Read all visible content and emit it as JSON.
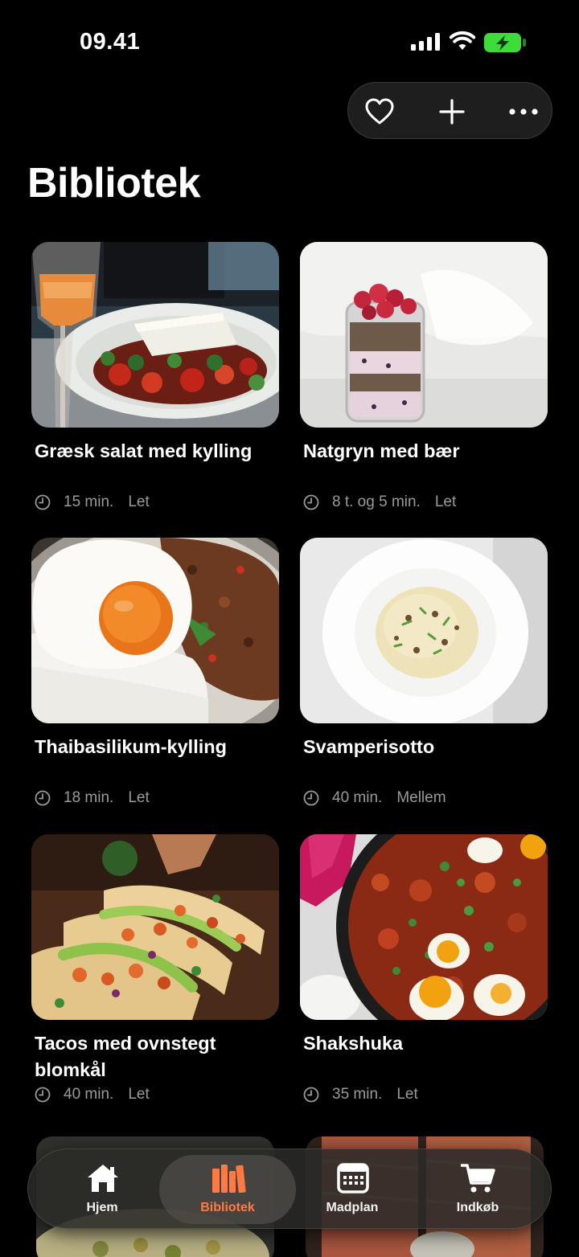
{
  "status_bar": {
    "time": "09.41",
    "icons": [
      "cellular-signal-icon",
      "wifi-icon",
      "battery-charging-icon"
    ],
    "battery_color": "#3ddc3a"
  },
  "toolbar": {
    "icons": [
      "heart-icon",
      "plus-icon",
      "more-icon"
    ]
  },
  "page_title": "Bibliotek",
  "recipes": [
    {
      "title": "Græsk salat med kylling",
      "time": "15 min.",
      "level": "Let",
      "image": "greek-salad-image"
    },
    {
      "title": "Natgryn med bær",
      "time": "8 t. og 5 min.",
      "level": "Let",
      "image": "overnight-oats-image"
    },
    {
      "title": "Thaibasilikum-kylling",
      "time": "18 min.",
      "level": "Let",
      "image": "thai-basil-chicken-image"
    },
    {
      "title": "Svamperisotto",
      "time": "40 min.",
      "level": "Mellem",
      "image": "mushroom-risotto-image"
    },
    {
      "title": "Tacos med ovnstegt blomkål",
      "time": "40 min.",
      "level": "Let",
      "image": "cauliflower-tacos-image"
    },
    {
      "title": "Shakshuka",
      "time": "35 min.",
      "level": "Let",
      "image": "shakshuka-image"
    }
  ],
  "tab_bar": {
    "tabs": [
      {
        "label": "Hjem",
        "icon": "home-icon"
      },
      {
        "label": "Bibliotek",
        "icon": "library-icon"
      },
      {
        "label": "Madplan",
        "icon": "calendar-icon"
      },
      {
        "label": "Indkøb",
        "icon": "cart-icon"
      }
    ],
    "active_index": 1,
    "active_color": "#ff7a45"
  }
}
